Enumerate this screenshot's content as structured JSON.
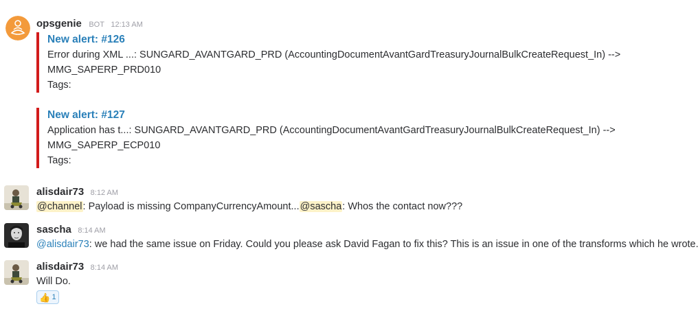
{
  "messages": [
    {
      "author": "opsgenie",
      "bot_tag": "BOT",
      "time": "12:13 AM",
      "attachments": [
        {
          "title": "New alert: #126",
          "line1": "Error during XML ...: SUNGARD_AVANTGARD_PRD (AccountingDocumentAvantGardTreasuryJournalBulkCreateRequest_In) -->",
          "line2": "MMG_SAPERP_PRD010",
          "tags": "Tags:"
        },
        {
          "title": "New alert: #127",
          "line1": "Application has t...: SUNGARD_AVANTGARD_PRD (AccountingDocumentAvantGardTreasuryJournalBulkCreateRequest_In) -->",
          "line2": "MMG_SAPERP_ECP010",
          "tags": "Tags:"
        }
      ]
    },
    {
      "author": "alisdair73",
      "time": "8:12 AM",
      "mention1": "@channel",
      "text1": ": Payload is missing CompanyCurrencyAmount...",
      "mention2": "@sascha",
      "text2": ": Whos the contact now???"
    },
    {
      "author": "sascha",
      "time": "8:14 AM",
      "mention": "@alisdair73",
      "text": ": we had the same issue on Friday. Could you please ask David Fagan to fix this? This is an issue in one of the transforms which he wrote."
    },
    {
      "author": "alisdair73",
      "time": "8:14 AM",
      "text": "Will Do.",
      "reaction": {
        "icon": "thumbs-up",
        "count": "1"
      }
    }
  ]
}
